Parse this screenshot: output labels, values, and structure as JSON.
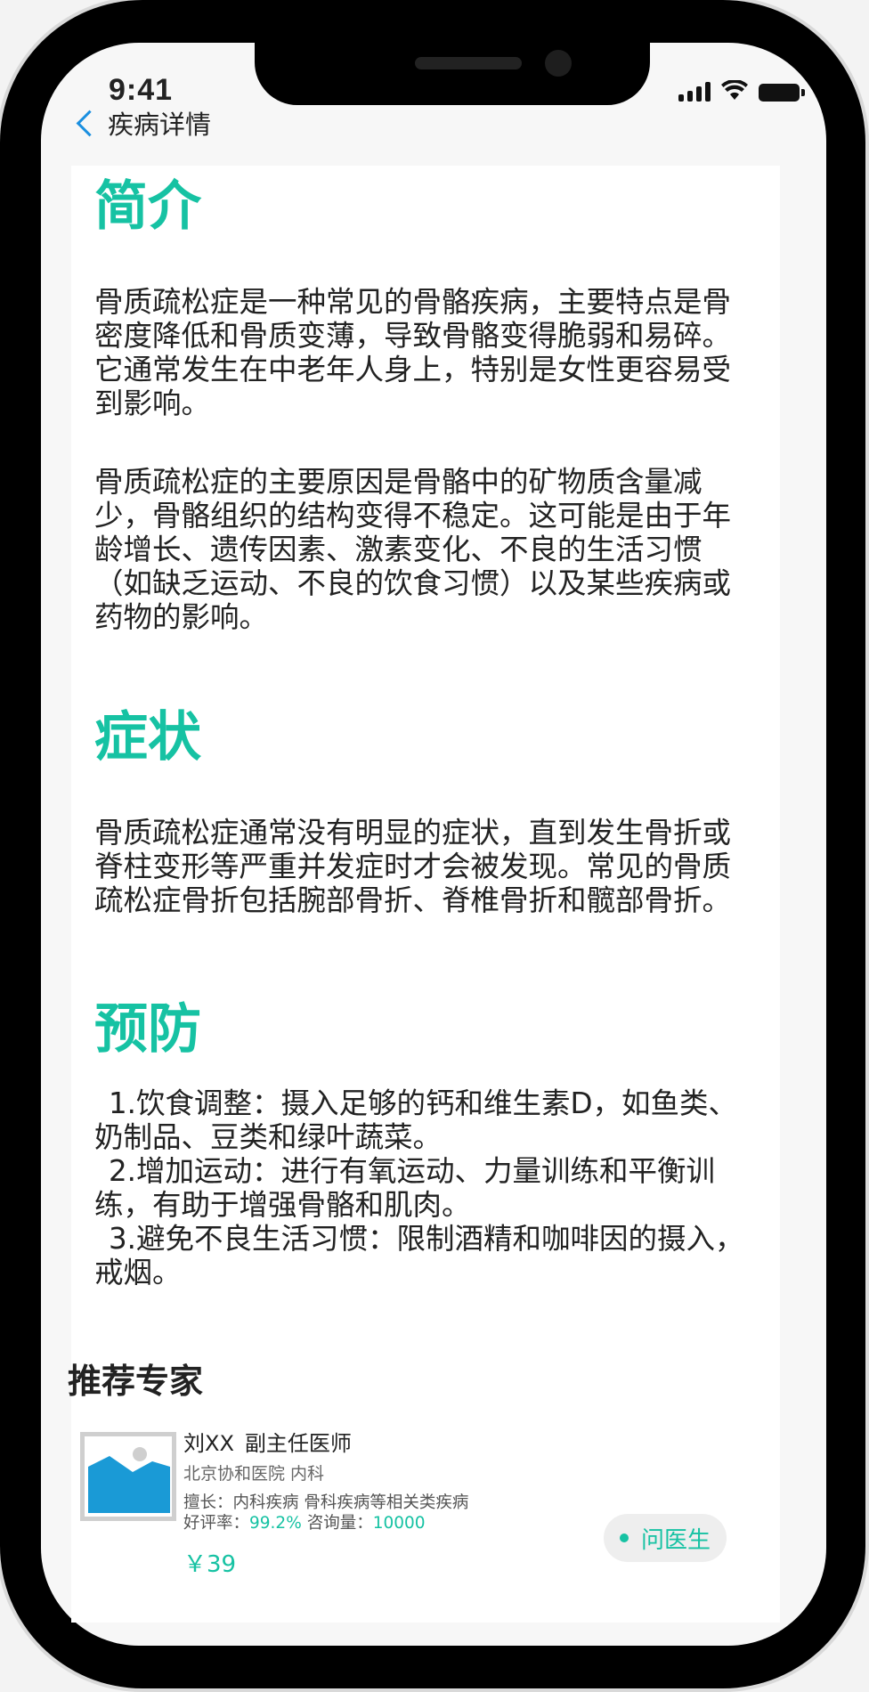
{
  "status_bar": {
    "time": "9:41"
  },
  "header": {
    "back_label": "疾病详情"
  },
  "sections": {
    "intro": {
      "title": "简介",
      "paragraphs": [
        "骨质疏松症是一种常见的骨骼疾病，主要特点是骨密度降低和骨质变薄，导致骨骼变得脆弱和易碎。它通常发生在中老年人身上，特别是女性更容易受到影响。",
        "骨质疏松症的主要原因是骨骼中的矿物质含量减少，骨骼组织的结构变得不稳定。这可能是由于年龄增长、遗传因素、激素变化、不良的生活习惯（如缺乏运动、不良的饮食习惯）以及某些疾病或药物的影响。"
      ]
    },
    "symptoms": {
      "title": "症状",
      "paragraph": "骨质疏松症通常没有明显的症状，直到发生骨折或脊柱变形等严重并发症时才会被发现。常见的骨质疏松症骨折包括腕部骨折、脊椎骨折和髋部骨折。"
    },
    "prevention": {
      "title": "预防",
      "items": [
        "1.饮食调整：摄入足够的钙和维生素D，如鱼类、奶制品、豆类和绿叶蔬菜。",
        "2.增加运动：进行有氧运动、力量训练和平衡训练，有助于增强骨骼和肌肉。",
        "3.避免不良生活习惯：限制酒精和咖啡因的摄入，戒烟。"
      ]
    }
  },
  "experts": {
    "title": "推荐专家",
    "list": [
      {
        "name": "刘XX",
        "rank": "副主任医师",
        "hospital": "北京协和医院 内科",
        "specialty": "擅长：内科疾病 骨科疾病等相关类疾病",
        "rating_label": "好评率：",
        "rating_value": "99.2%",
        "consult_label": "咨询量：",
        "consult_value": "10000",
        "price": "￥39",
        "ask_label": "问医生"
      }
    ]
  },
  "colors": {
    "accent": "#16c2a3",
    "back_icon": "#1a8fe0",
    "avatar_image": "#1a9ad6"
  }
}
